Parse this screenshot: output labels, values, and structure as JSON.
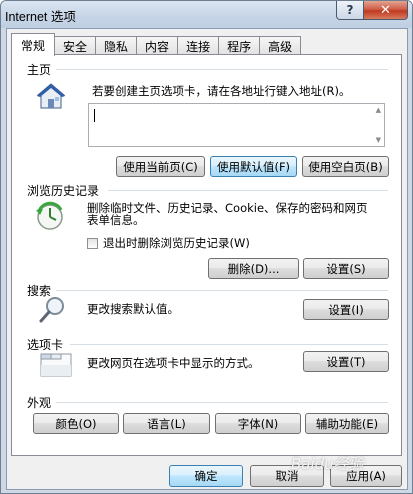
{
  "window": {
    "title": "Internet 选项",
    "help_label": "?",
    "close_label": "✕"
  },
  "tabs": [
    {
      "label": "常规"
    },
    {
      "label": "安全"
    },
    {
      "label": "隐私"
    },
    {
      "label": "内容"
    },
    {
      "label": "连接"
    },
    {
      "label": "程序"
    },
    {
      "label": "高级"
    }
  ],
  "home": {
    "title": "主页",
    "description": "若要创建主页选项卡，请在各地址行键入地址(R)。",
    "address_value": "",
    "buttons": {
      "use_current": "使用当前页(C)",
      "use_default": "使用默认值(F)",
      "use_blank": "使用空白页(B)"
    }
  },
  "history": {
    "title": "浏览历史记录",
    "description_line1": "删除临时文件、历史记录、Cookie、保存的密码和网页",
    "description_line2": "表单信息。",
    "checkbox_label": "退出时删除浏览历史记录(W)",
    "delete_button": "删除(D)...",
    "settings_button": "设置(S)"
  },
  "search": {
    "title": "搜索",
    "description": "更改搜索默认值。",
    "settings_button": "设置(I)"
  },
  "tabs_section": {
    "title": "选项卡",
    "description": "更改网页在选项卡中显示的方式。",
    "settings_button": "设置(T)"
  },
  "appearance": {
    "title": "外观",
    "colors_button": "颜色(O)",
    "languages_button": "语言(L)",
    "fonts_button": "字体(N)",
    "accessibility_button": "辅助功能(E)"
  },
  "footer": {
    "ok_button": "确定",
    "cancel_button": "取消",
    "apply_button": "应用(A)"
  },
  "watermark": "Baidu经验"
}
